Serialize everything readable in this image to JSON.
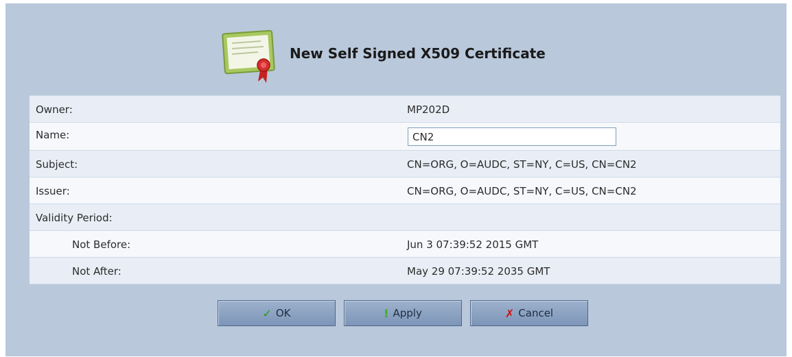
{
  "header": {
    "title": "New Self Signed X509 Certificate",
    "icon": "certificate-icon"
  },
  "rows": {
    "owner": {
      "label": "Owner:",
      "value": "MP202D"
    },
    "name": {
      "label": "Name:",
      "input_value": "CN2"
    },
    "subject": {
      "label": "Subject:",
      "value": "CN=ORG, O=AUDC, ST=NY, C=US, CN=CN2"
    },
    "issuer": {
      "label": "Issuer:",
      "value": "CN=ORG, O=AUDC, ST=NY, C=US, CN=CN2"
    },
    "validity": {
      "label": "Validity Period:"
    },
    "not_before": {
      "label": "Not Before:",
      "value": "Jun 3 07:39:52 2015 GMT"
    },
    "not_after": {
      "label": "Not After:",
      "value": "May 29 07:39:52 2035 GMT"
    }
  },
  "buttons": {
    "ok": {
      "label": "OK",
      "icon": "check-icon"
    },
    "apply": {
      "label": "Apply",
      "icon": "exclamation-icon"
    },
    "cancel": {
      "label": "Cancel",
      "icon": "x-icon"
    }
  },
  "colors": {
    "panel_bg": "#b9c8db",
    "row_odd": "#e9eef6",
    "row_even": "#f6f8fc",
    "button_bg": "#8aa0c2"
  }
}
